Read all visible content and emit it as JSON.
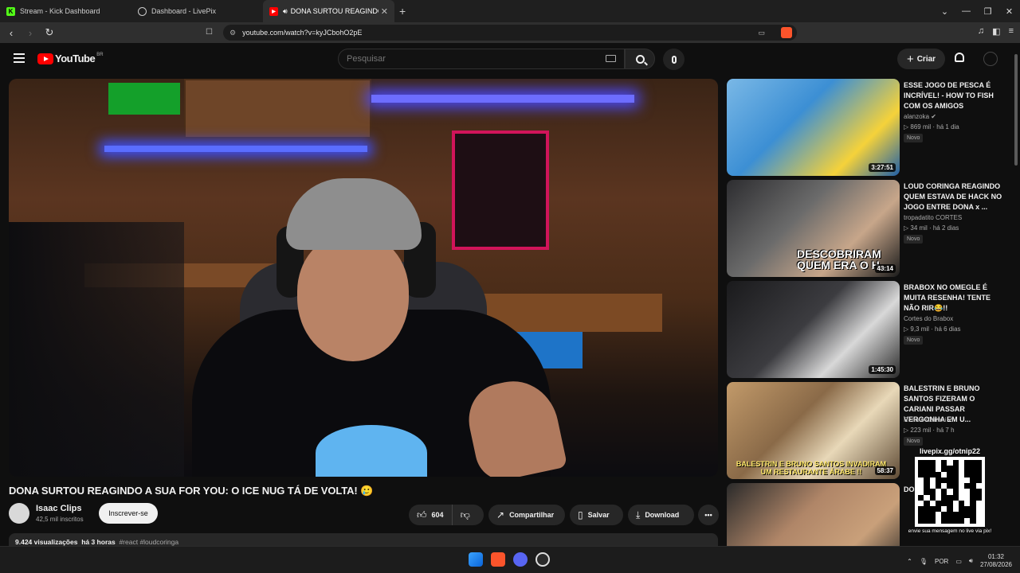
{
  "browser": {
    "tabs": [
      {
        "label": "Stream - Kick Dashboard",
        "fav_color": "#53fc18",
        "fav_glyph": "K"
      },
      {
        "label": "Dashboard - LivePix",
        "fav_color": "#cccccc",
        "fav_glyph": ""
      },
      {
        "label": "DONA SURTOU REAGINDO A",
        "fav_color": "#ff0000",
        "fav_glyph": "▶"
      }
    ],
    "url": "youtube.com/watch?v=kyJCbohO2pE"
  },
  "youtube": {
    "logo_text": "YouTube",
    "logo_region": "BR",
    "search_placeholder": "Pesquisar",
    "create_label": "Criar"
  },
  "video": {
    "title": "DONA SURTOU REAGINDO A SUA FOR YOU: O ICE NUG TÁ DE VOLTA! 🥲",
    "channel": "Isaac Clips",
    "subscribers": "42,5 mil inscritos",
    "subscribe_label": "Inscrever-se",
    "likes": "604",
    "share_label": "Compartilhar",
    "save_label": "Salvar",
    "download_label": "Download",
    "views": "9.424 visualizações",
    "age": "há 3 horas",
    "tags": "#react #loudcoringa"
  },
  "recommendations": [
    {
      "title": "ESSE JOGO DE PESCA É INCRÍVEL! - HOW TO FISH COM OS AMIGOS",
      "channel": "alanzoka",
      "views": "869 mil",
      "age": "há 1 dia",
      "duration": "3:27:51",
      "badge": "Novo"
    },
    {
      "title": "LOUD CORINGA REAGINDO QUEM ESTAVA DE HACK NO JOGO ENTRE DONA x ...",
      "channel": "tropadatito CORTES",
      "views": "34 mil",
      "age": "há 2 dias",
      "duration": "43:14",
      "badge": "Novo",
      "caption": "DESCOBRIRAM QUEM ERA O H..."
    },
    {
      "title": "BRABOX NO OMEGLE É MUITA RESENHA! TENTE NÃO RIR😂!!",
      "channel": "Cortes do Brabox",
      "views": "9,3 mil",
      "age": "há 6 dias",
      "duration": "1:45:30",
      "badge": "Novo"
    },
    {
      "title": "BALESTRIN E BRUNO SANTOS FIZERAM O CARIANI PASSAR VERGONHA EM U...",
      "channel": "Renato Cariani",
      "views": "223 mil",
      "age": "há 7 h",
      "duration": "58:37",
      "badge": "Novo",
      "caption": "BALESTRIN E BRUNO SANTOS INVADIRAM UM RESTAURANTE ÁRABE !!"
    },
    {
      "title": "DO... OR X... EX...",
      "channel": "",
      "views": "",
      "age": "",
      "duration": "",
      "badge": ""
    }
  ],
  "overlay": {
    "qr_url": "livepix.gg/otnip22",
    "qr_text": "envie sua mensagem no live via pix!"
  },
  "taskbar": {
    "lang": "POR",
    "time": "01:32",
    "date": "27/08/2026"
  }
}
